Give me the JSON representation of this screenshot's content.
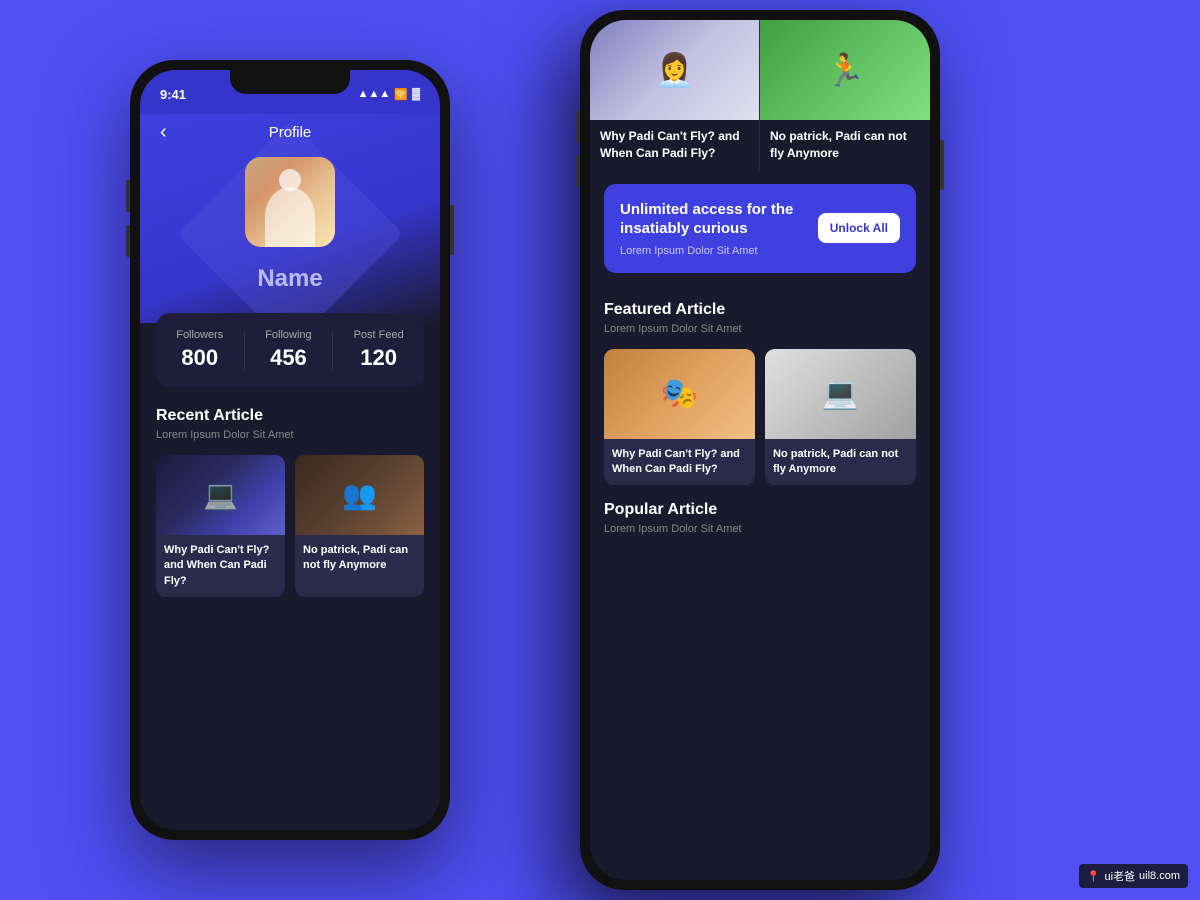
{
  "background_color": "#4f4ff5",
  "left_phone": {
    "status_bar": {
      "time": "9:41",
      "signal_icon": "signal",
      "wifi_icon": "wifi",
      "battery_icon": "battery"
    },
    "profile": {
      "back_label": "‹",
      "title": "Profile",
      "user_name": "Name",
      "stats": {
        "followers_label": "Followers",
        "followers_value": "800",
        "following_label": "Following",
        "following_value": "456",
        "postfeed_label": "Post Feed",
        "postfeed_value": "120"
      },
      "recent_article": {
        "section_title": "Recent Article",
        "section_subtitle": "Lorem Ipsum Dolor Sit Amet",
        "articles": [
          {
            "title": "Why Padi Can't Fly? and When Can Padi Fly?",
            "thumb_type": "laptop"
          },
          {
            "title": "No patrick, Padi can not fly Anymore",
            "thumb_type": "meeting"
          }
        ]
      }
    }
  },
  "right_phone": {
    "feed": {
      "top_articles": [
        {
          "title": "Why Padi  Can't Fly? and When Can Padi Fly?",
          "thumb_type": "office"
        },
        {
          "title": "No patrick, Padi can not fly Anymore",
          "thumb_type": "sports"
        }
      ],
      "promo": {
        "headline": "Unlimited access for the insatiably curious",
        "subtitle": "Lorem Ipsum Dolor Sit Amet",
        "button_label": "Unlock All"
      },
      "featured": {
        "section_title": "Featured Article",
        "section_subtitle": "Lorem Ipsum Dolor Sit Amet",
        "articles": [
          {
            "title": "Why Padi  Can't Fly? and When Can Padi Fly?",
            "thumb_type": "skater"
          },
          {
            "title": "No patrick, Padi can not fly Anymore",
            "thumb_type": "laptop2"
          }
        ]
      },
      "popular": {
        "section_title": "Popular Article",
        "section_subtitle": "Lorem Ipsum Dolor Sit Amet"
      }
    }
  },
  "watermark": {
    "icon": "📍",
    "text": "ui老爸",
    "url": "uil8.com"
  }
}
